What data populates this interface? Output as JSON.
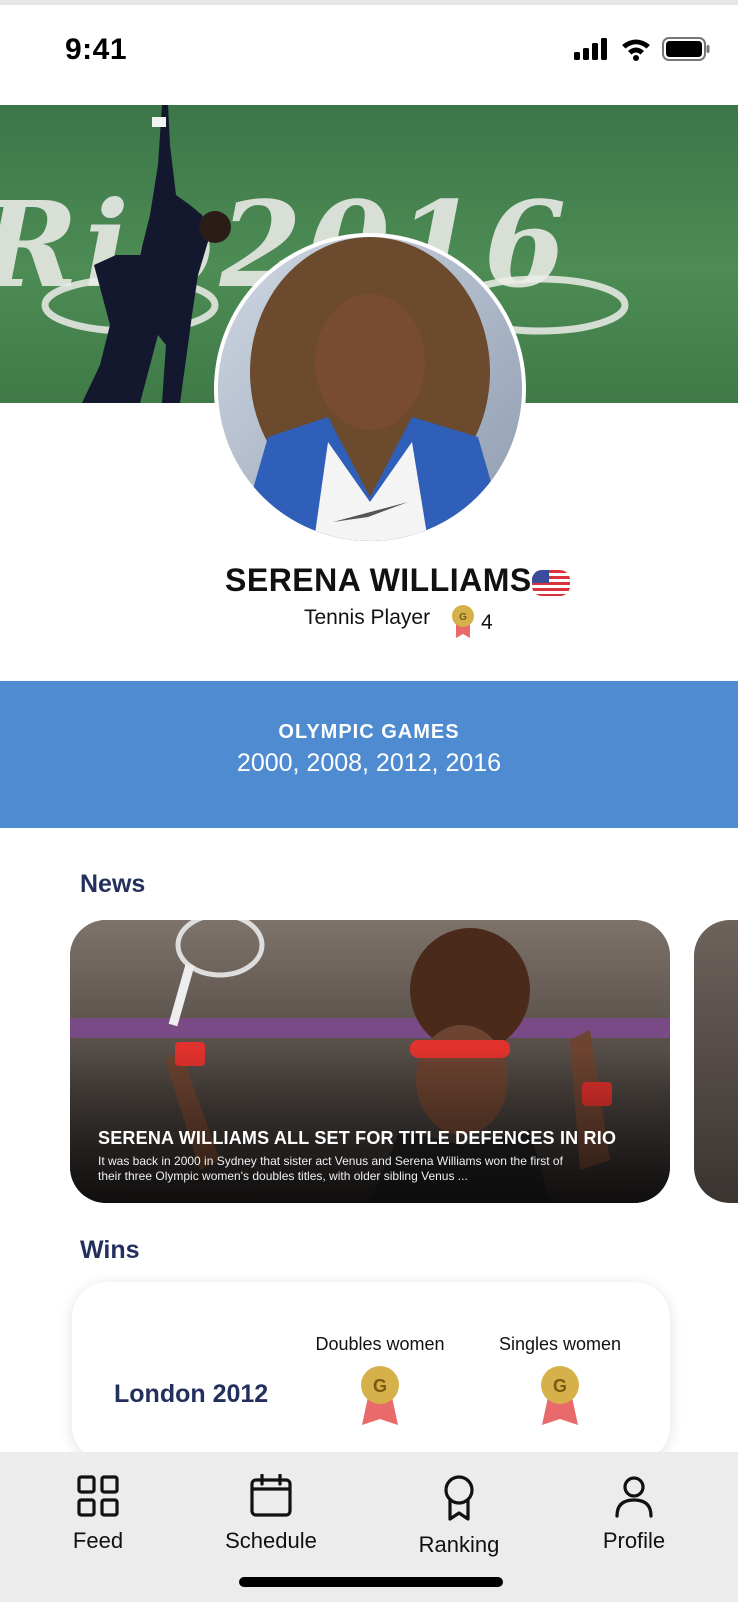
{
  "status_bar": {
    "time": "9:41"
  },
  "profile": {
    "name": "SERENA WILLIAMS",
    "role": "Tennis Player",
    "medal_letter": "G",
    "medal_count": "4",
    "flag": "us-flag-icon"
  },
  "cover": {
    "text": "Rio2016"
  },
  "olympics": {
    "title": "OLYMPIC GAMES",
    "years": "2000, 2008, 2012, 2016"
  },
  "news": {
    "heading": "News",
    "items": [
      {
        "title": "SERENA WILLIAMS ALL SET FOR TITLE DEFENCES IN RIO",
        "excerpt": "It was back in 2000 in Sydney that sister act Venus and Serena Williams won the first of their three Olympic women's doubles titles, with older sibling Venus ..."
      }
    ]
  },
  "wins": {
    "heading": "Wins",
    "rows": [
      {
        "event": "London 2012",
        "columns": [
          {
            "label": "Doubles women",
            "medal": "G"
          },
          {
            "label": "Singles women",
            "medal": "G"
          }
        ]
      }
    ]
  },
  "tab_bar": {
    "items": [
      {
        "label": "Feed",
        "icon": "grid-icon"
      },
      {
        "label": "Schedule",
        "icon": "calendar-icon"
      },
      {
        "label": "Ranking",
        "icon": "ranking-medal-icon"
      },
      {
        "label": "Profile",
        "icon": "person-icon"
      }
    ]
  },
  "colors": {
    "banner": "#4e8bd0",
    "heading": "#23305e",
    "medal_gold": "#d6b04a",
    "medal_ribbon": "#e96a6a",
    "tab_bar": "#ececec"
  }
}
